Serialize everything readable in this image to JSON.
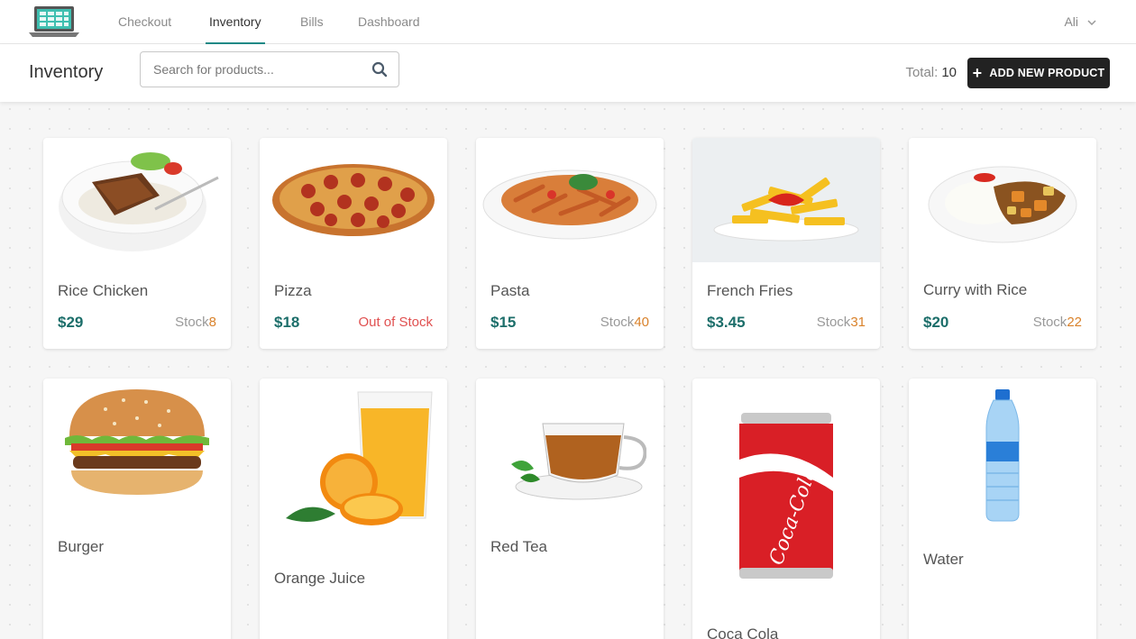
{
  "nav": {
    "tabs": [
      {
        "label": "Checkout"
      },
      {
        "label": "Inventory"
      },
      {
        "label": "Bills"
      },
      {
        "label": "Dashboard"
      }
    ],
    "active_tab": "Inventory",
    "user": "Ali"
  },
  "toolbar": {
    "title": "Inventory",
    "search_placeholder": "Search for products...",
    "total_label": "Total:",
    "total_value": "10",
    "add_button_label": "ADD NEW PRODUCT"
  },
  "products": [
    {
      "name": "Rice Chicken",
      "price": "$29",
      "stock_label": "Stock",
      "stock": "8",
      "icon": "rice-chicken-image"
    },
    {
      "name": "Pizza",
      "price": "$18",
      "stock_label": "Out of Stock",
      "stock": "",
      "icon": "pizza-image"
    },
    {
      "name": "Pasta",
      "price": "$15",
      "stock_label": "Stock",
      "stock": "40",
      "icon": "pasta-image"
    },
    {
      "name": "French Fries",
      "price": "$3.45",
      "stock_label": "Stock",
      "stock": "31",
      "icon": "french-fries-image"
    },
    {
      "name": "Curry with Rice",
      "price": "$20",
      "stock_label": "Stock",
      "stock": "22",
      "icon": "curry-rice-image"
    },
    {
      "name": "Burger",
      "icon": "burger-image"
    },
    {
      "name": "Orange Juice",
      "icon": "orange-juice-image"
    },
    {
      "name": "Red Tea",
      "icon": "red-tea-image"
    },
    {
      "name": "Coca Cola",
      "icon": "coca-cola-image"
    },
    {
      "name": "Water",
      "icon": "water-bottle-image"
    }
  ],
  "colors": {
    "accent": "#1e8a87",
    "price": "#1c6e6a",
    "stock_qty": "#d9822b",
    "out_of_stock": "#e05050",
    "button_bg": "#222222"
  }
}
